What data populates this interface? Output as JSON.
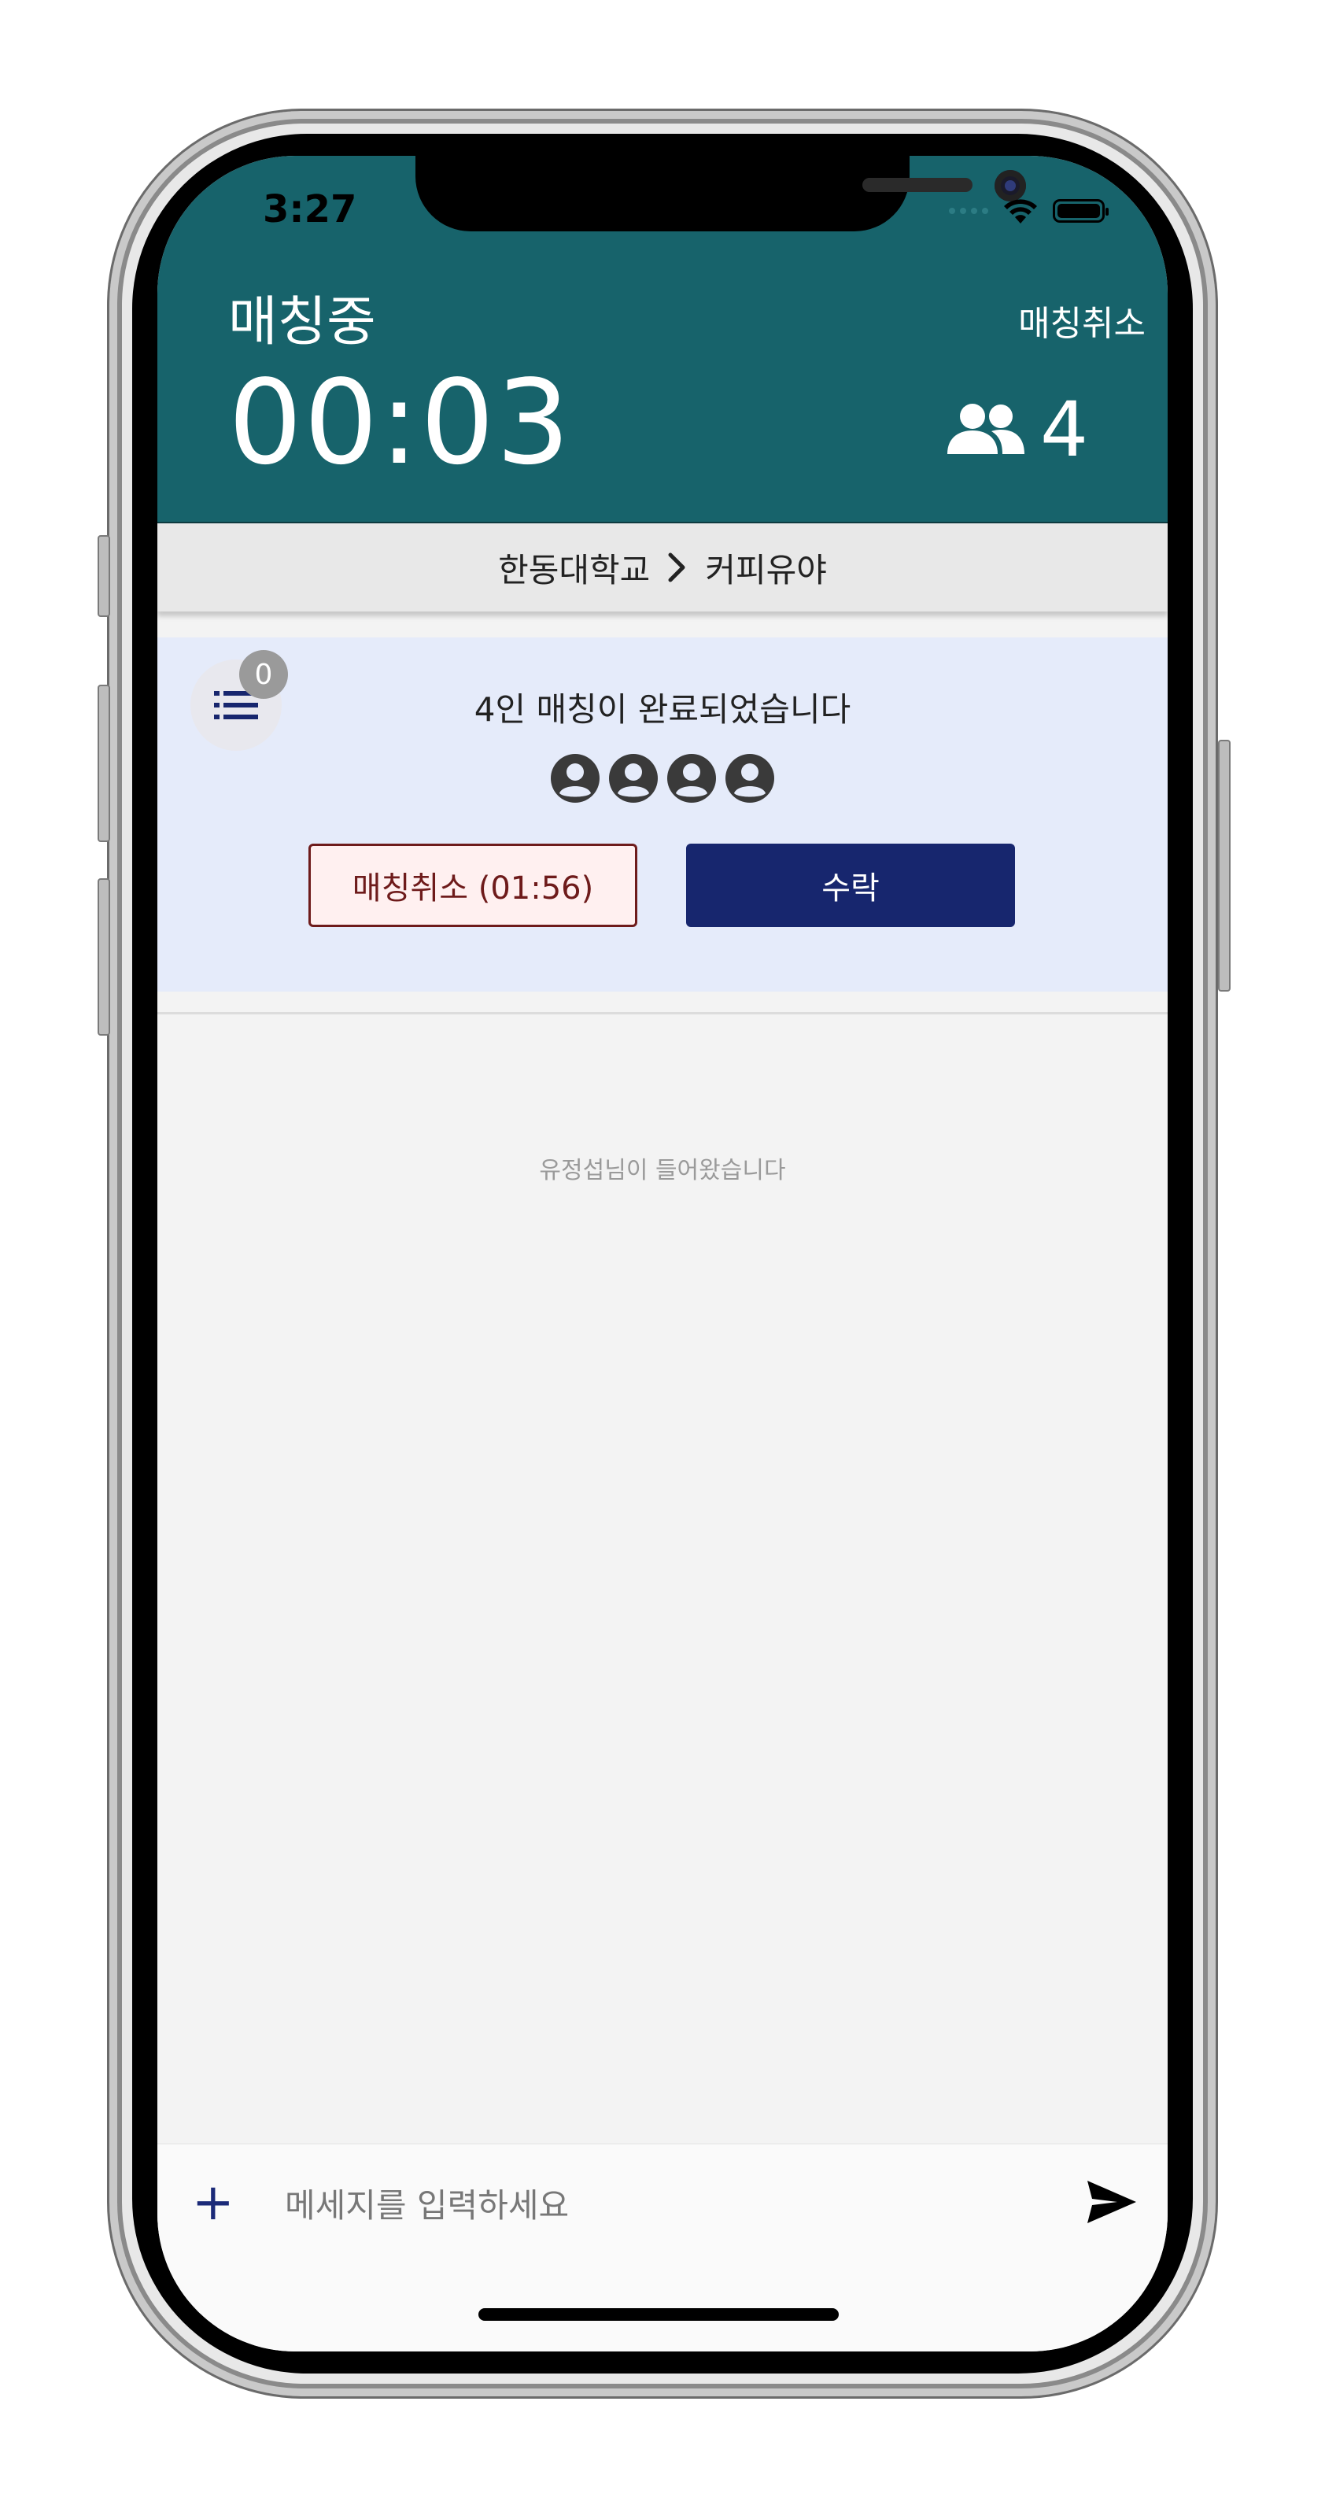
{
  "status_bar": {
    "time": "3:27"
  },
  "header": {
    "title": "매칭중",
    "cancel_label": "매칭취소",
    "timer": "00:03",
    "people_count": "4"
  },
  "breadcrumb": {
    "from": "한동대학교",
    "to": "커피유야"
  },
  "match_panel": {
    "badge_count": "0",
    "message": "4인 매칭이 완료되었습니다",
    "avatars": 4,
    "cancel_button": "매칭취소 (01:56)",
    "accept_button": "수락"
  },
  "chat": {
    "system_message": "유정섭님이 들어왔습니다"
  },
  "input_bar": {
    "placeholder": "메세지를 입력하세요"
  },
  "colors": {
    "header": "#17636b",
    "accent": "#17266e",
    "cancel": "#6e1b1b",
    "panel": "#e5ebfa"
  }
}
